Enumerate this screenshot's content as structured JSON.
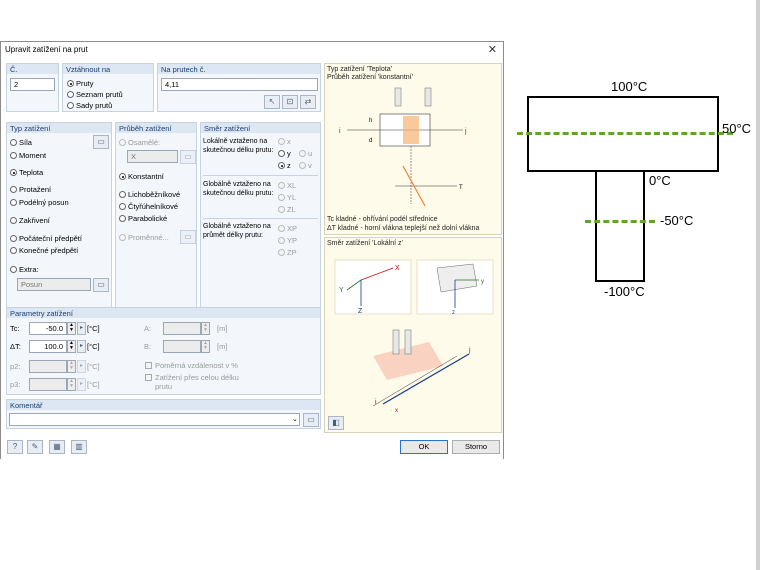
{
  "dialog": {
    "title": "Upravit zatížení na prut",
    "no_group": {
      "header": "Č.",
      "value": "2"
    },
    "relate_group": {
      "header": "Vztáhnout na",
      "options": [
        "Pruty",
        "Seznam prutů",
        "Sady prutů"
      ]
    },
    "members_group": {
      "header": "Na prutech č.",
      "value": "4,11"
    },
    "load_type": {
      "header": "Typ zatížení",
      "items": [
        "Síla",
        "Moment",
        "Teplota",
        "Protažení",
        "Podélný posun",
        "Zakřivení",
        "Počáteční předpětí",
        "Konečné předpětí",
        "Extra:"
      ],
      "extra_value": "Posun"
    },
    "distribution": {
      "header": "Průběh zatížení",
      "concentrated": "Osamělé:",
      "concentrated_value": "X",
      "items": [
        "Konstantní",
        "Lichoběžníkové",
        "Čtyřúhelníkové",
        "Parabolické",
        "Proměnné..."
      ]
    },
    "direction": {
      "header": "Směr zatížení",
      "local_label": "Lokálně vztaženo na skutečnou délku prutu:",
      "local_options": [
        "x",
        "y",
        "u",
        "z",
        "v"
      ],
      "global_true_label": "Globálně vztaženo na skutečnou délku prutu:",
      "global_true_options": [
        "XL",
        "YL",
        "ZL"
      ],
      "global_proj_label": "Globálně vztaženo na průmět délky prutu:",
      "global_proj_options": [
        "XP",
        "YP",
        "ZP"
      ]
    },
    "params": {
      "header": "Parametry zatížení",
      "tc_label": "Tc:",
      "tc_value": "-50.0",
      "tc_unit": "[°C]",
      "dt_label": "ΔT:",
      "dt_value": "100.0",
      "dt_unit": "[°C]",
      "p2_label": "p2:",
      "p2_unit": "[°C]",
      "p3_label": "p3:",
      "p3_unit": "[°C]",
      "a_label": "A:",
      "a_unit": "[m]",
      "b_label": "B:",
      "b_unit": "[m]",
      "relative_label": "Poměrná vzdálenost v %",
      "fulllength_label": "Zatížení přes celou délku prutu"
    },
    "comment": {
      "header": "Komentář",
      "value": ""
    },
    "preview": {
      "title1": "Typ zatížení 'Teplota'",
      "title2": "Průběh zatížení 'konstantní'",
      "note1": "Tc kladné - ohřívání podél střednice",
      "note2": "ΔT kladné - horní vlákna teplejší než dolní vlákna",
      "title3": "Směr zatížení 'Lokální z'",
      "axis_labels": [
        "i",
        "j",
        "h",
        "d",
        "T",
        "X",
        "Y",
        "Z",
        "y",
        "z",
        "x"
      ]
    },
    "ok_label": "OK",
    "cancel_label": "Storno"
  },
  "diagram": {
    "labels": [
      "100°C",
      "50°C",
      "0°C",
      "-50°C",
      "-100°C"
    ]
  },
  "colors": {
    "accent": "#1a3f70",
    "dash": "#5fa52c",
    "panel": "#fffbea"
  }
}
